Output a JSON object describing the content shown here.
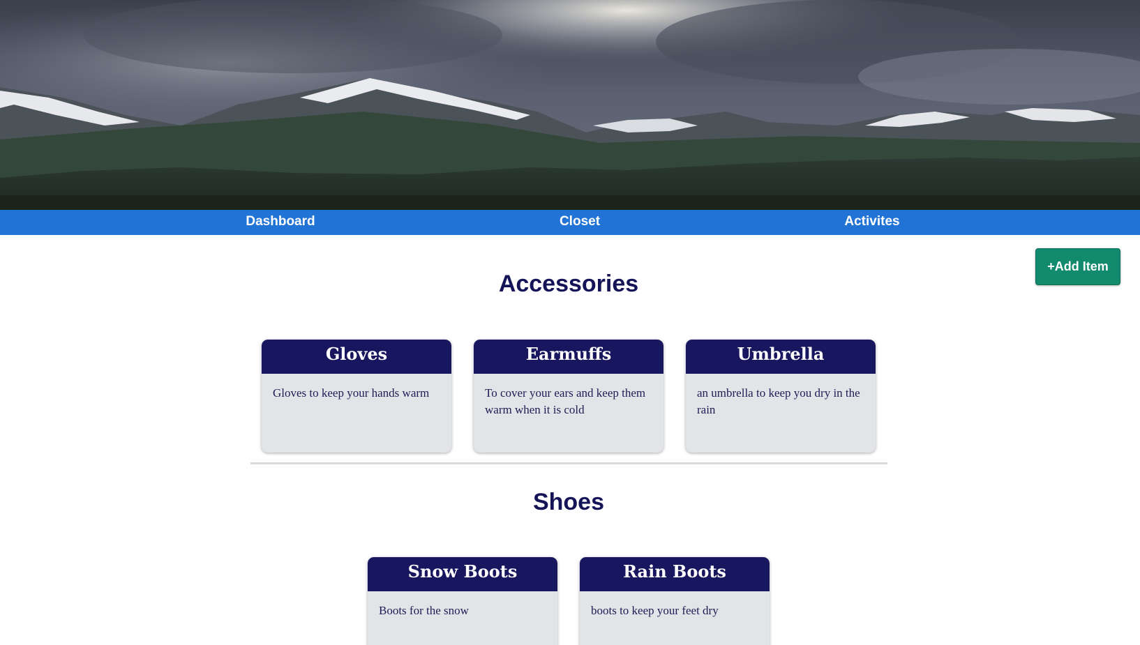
{
  "nav": {
    "items": [
      {
        "label": "Dashboard"
      },
      {
        "label": "Closet"
      },
      {
        "label": "Activites"
      }
    ]
  },
  "actions": {
    "add_item_label": "+Add Item"
  },
  "sections": [
    {
      "title": "Accessories",
      "items": [
        {
          "name": "Gloves",
          "description": "Gloves to keep your hands warm"
        },
        {
          "name": "Earmuffs",
          "description": "To cover your ears and keep them warm when it is cold"
        },
        {
          "name": "Umbrella",
          "description": "an umbrella to keep you dry in the rain"
        }
      ]
    },
    {
      "title": "Shoes",
      "items": [
        {
          "name": "Snow Boots",
          "description": "Boots for the snow"
        },
        {
          "name": "Rain Boots",
          "description": "boots to keep your feet dry"
        }
      ]
    }
  ],
  "colors": {
    "nav_bg": "#2273d6",
    "heading": "#151458",
    "card_header": "#17165e",
    "card_body": "#e3e4e8",
    "add_button": "#128a6d"
  }
}
